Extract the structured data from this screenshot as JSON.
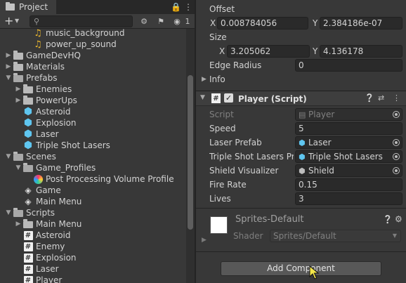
{
  "project": {
    "tab_label": "Project",
    "toolbar": {
      "add": "+",
      "hidden_count": "1"
    },
    "tree": [
      {
        "label": "music_background",
        "icon": "music-icon",
        "indent": 3,
        "arrow": ""
      },
      {
        "label": "power_up_sound",
        "icon": "music-icon",
        "indent": 3,
        "arrow": ""
      },
      {
        "label": "GameDevHQ",
        "icon": "folder-icon",
        "indent": 1,
        "arrow": "right"
      },
      {
        "label": "Materials",
        "icon": "folder-icon",
        "indent": 1,
        "arrow": "right"
      },
      {
        "label": "Prefabs",
        "icon": "folder-open-icon",
        "indent": 1,
        "arrow": "down"
      },
      {
        "label": "Enemies",
        "icon": "folder-icon",
        "indent": 2,
        "arrow": "right"
      },
      {
        "label": "PowerUps",
        "icon": "folder-icon",
        "indent": 2,
        "arrow": "right"
      },
      {
        "label": "Asteroid",
        "icon": "prefab-icon",
        "indent": 2,
        "arrow": ""
      },
      {
        "label": "Explosion",
        "icon": "prefab-icon",
        "indent": 2,
        "arrow": ""
      },
      {
        "label": "Laser",
        "icon": "prefab-icon",
        "indent": 2,
        "arrow": ""
      },
      {
        "label": "Triple Shot Lasers",
        "icon": "prefab-icon",
        "indent": 2,
        "arrow": ""
      },
      {
        "label": "Scenes",
        "icon": "folder-open-icon",
        "indent": 1,
        "arrow": "down"
      },
      {
        "label": "Game_Profiles",
        "icon": "folder-open-icon",
        "indent": 2,
        "arrow": "down"
      },
      {
        "label": "Post Processing Volume Profile",
        "icon": "post-processing-icon",
        "indent": 3,
        "arrow": ""
      },
      {
        "label": "Game",
        "icon": "unity-scene-icon",
        "indent": 2,
        "arrow": ""
      },
      {
        "label": "Main Menu",
        "icon": "unity-scene-icon",
        "indent": 2,
        "arrow": ""
      },
      {
        "label": "Scripts",
        "icon": "folder-open-icon",
        "indent": 1,
        "arrow": "down"
      },
      {
        "label": "Main Menu",
        "icon": "folder-icon",
        "indent": 2,
        "arrow": "right"
      },
      {
        "label": "Asteroid",
        "icon": "script-icon",
        "indent": 2,
        "arrow": ""
      },
      {
        "label": "Enemy",
        "icon": "script-icon",
        "indent": 2,
        "arrow": ""
      },
      {
        "label": "Explosion",
        "icon": "script-icon",
        "indent": 2,
        "arrow": ""
      },
      {
        "label": "Laser",
        "icon": "script-icon",
        "indent": 2,
        "arrow": ""
      },
      {
        "label": "Player",
        "icon": "script-icon",
        "indent": 2,
        "arrow": ""
      }
    ]
  },
  "inspector": {
    "collider": {
      "offset_label": "Offset",
      "offset_x": "0.008784056",
      "offset_y": "2.384186e-07",
      "size_label": "Size",
      "size_x": "3.205062",
      "size_y": "4.136178",
      "edge_radius_label": "Edge Radius",
      "edge_radius": "0",
      "info_label": "Info",
      "axis_x": "X",
      "axis_y": "Y"
    },
    "player_script": {
      "title": "Player (Script)",
      "enabled": true,
      "script_label": "Script",
      "script_value": "Player",
      "speed_label": "Speed",
      "speed_value": "5",
      "laser_prefab_label": "Laser Prefab",
      "laser_prefab_value": "Laser",
      "triple_shot_label": "Triple Shot Lasers Pre",
      "triple_shot_value": "Triple Shot Lasers",
      "shield_label": "Shield Visualizer",
      "shield_value": "Shield",
      "fire_rate_label": "Fire Rate",
      "fire_rate_value": "0.15",
      "lives_label": "Lives",
      "lives_value": "3"
    },
    "material": {
      "name": "Sprites-Default",
      "shader_label": "Shader",
      "shader_value": "Sprites/Default"
    },
    "add_component_label": "Add Component"
  }
}
